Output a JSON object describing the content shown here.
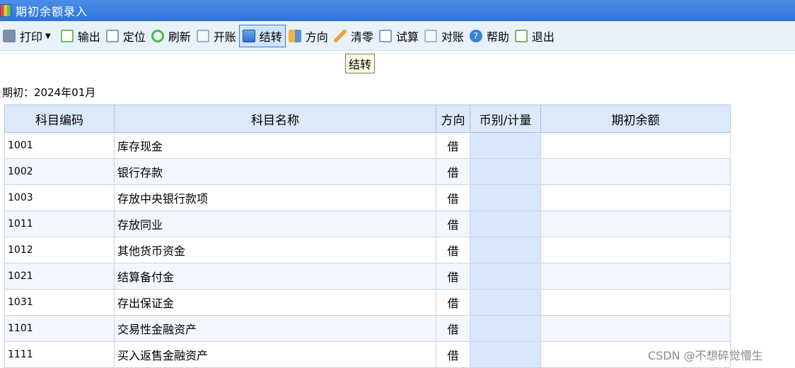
{
  "window": {
    "title": "期初余额录入"
  },
  "toolbar": {
    "buttons": [
      {
        "label": "打印",
        "icon": "printer-icon"
      },
      {
        "label": "输出",
        "icon": "export-icon"
      },
      {
        "label": "定位",
        "icon": "locate-icon"
      },
      {
        "label": "刷新",
        "icon": "refresh-icon"
      },
      {
        "label": "开账",
        "icon": "open-ledger-icon"
      },
      {
        "label": "结转",
        "icon": "carry-forward-icon"
      },
      {
        "label": "方向",
        "icon": "direction-icon"
      },
      {
        "label": "清零",
        "icon": "clear-icon"
      },
      {
        "label": "试算",
        "icon": "trial-balance-icon"
      },
      {
        "label": "对账",
        "icon": "reconcile-icon"
      },
      {
        "label": "帮助",
        "icon": "help-icon"
      },
      {
        "label": "退出",
        "icon": "exit-icon"
      }
    ],
    "active": "结转"
  },
  "tooltip": {
    "text": "结转"
  },
  "period": {
    "label": "期初：2024年01月"
  },
  "table": {
    "headers": [
      "科目编码",
      "科目名称",
      "方向",
      "币别/计量",
      "期初余额"
    ],
    "rows": [
      {
        "code": "1001",
        "name": "库存现金",
        "dir": "借",
        "unit": "",
        "balance": ""
      },
      {
        "code": "1002",
        "name": "银行存款",
        "dir": "借",
        "unit": "",
        "balance": ""
      },
      {
        "code": "1003",
        "name": "存放中央银行款项",
        "dir": "借",
        "unit": "",
        "balance": ""
      },
      {
        "code": "1011",
        "name": "存放同业",
        "dir": "借",
        "unit": "",
        "balance": ""
      },
      {
        "code": "1012",
        "name": "其他货币资金",
        "dir": "借",
        "unit": "",
        "balance": ""
      },
      {
        "code": "1021",
        "name": "结算备付金",
        "dir": "借",
        "unit": "",
        "balance": ""
      },
      {
        "code": "1031",
        "name": "存出保证金",
        "dir": "借",
        "unit": "",
        "balance": ""
      },
      {
        "code": "1101",
        "name": "交易性金融资产",
        "dir": "借",
        "unit": "",
        "balance": ""
      },
      {
        "code": "1111",
        "name": "买入返售金融资产",
        "dir": "借",
        "unit": "",
        "balance": ""
      }
    ]
  },
  "watermark": "CSDN @不想碎觉懵生"
}
